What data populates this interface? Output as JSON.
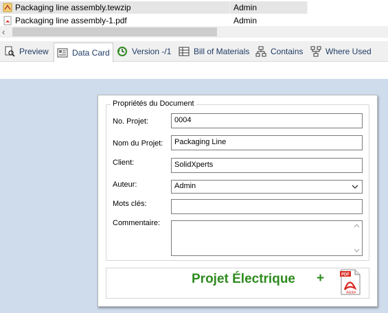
{
  "files": [
    {
      "name": "Packaging line assembly.tewzip",
      "owner": "Admin",
      "icon": "zip-file-icon"
    },
    {
      "name": "Packaging line assembly-1.pdf",
      "owner": "Admin",
      "icon": "pdf-file-icon"
    }
  ],
  "scrollbar": {
    "left_arrow": "‹"
  },
  "tabs": [
    {
      "label": "Preview",
      "icon": "preview-icon"
    },
    {
      "label": "Data Card",
      "icon": "data-card-icon",
      "active": true
    },
    {
      "label": "Version -/1",
      "icon": "version-icon"
    },
    {
      "label": "Bill of Materials",
      "icon": "bom-icon"
    },
    {
      "label": "Contains",
      "icon": "contains-icon"
    },
    {
      "label": "Where Used",
      "icon": "where-used-icon"
    }
  ],
  "card": {
    "group_title": "Propriétés du Document",
    "fields": {
      "project_no": {
        "label": "No. Projet:",
        "value": "0004"
      },
      "project_name": {
        "label": "Nom du Projet:",
        "value": "Packaging Line"
      },
      "client": {
        "label": "Client:",
        "value": "SolidXperts"
      },
      "author": {
        "label": "Auteur:",
        "value": "Admin"
      },
      "keywords": {
        "label": "Mots clés:",
        "value": ""
      },
      "comment": {
        "label": "Commentaire:",
        "value": ""
      }
    },
    "footer": {
      "title": "Projet Électrique",
      "plus": "+",
      "pdf_label": "Adobe"
    }
  },
  "colors": {
    "canvas": "#cfdcec",
    "accent_green": "#2e8b1e",
    "tab_text": "#1f3c66"
  }
}
